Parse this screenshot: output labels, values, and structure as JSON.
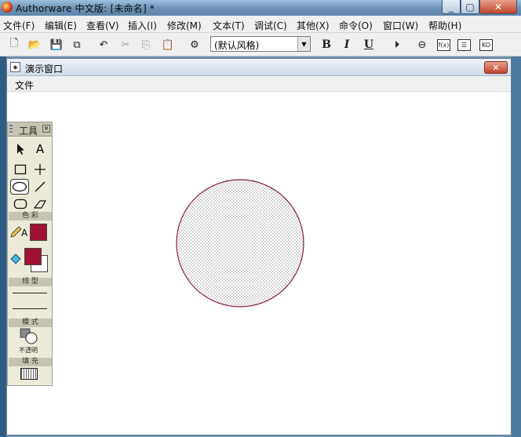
{
  "app": {
    "title": "Authorware 中文版: [未命名] *"
  },
  "menubar": {
    "items": [
      "文件(F)",
      "编辑(E)",
      "查看(V)",
      "插入(I)",
      "修改(M)",
      "文本(T)",
      "调试(C)",
      "其他(X)",
      "命令(O)",
      "窗口(W)",
      "帮助(H)"
    ]
  },
  "toolbar": {
    "style_value": "(默认风格)",
    "bold_label": "B",
    "italic_label": "I",
    "underline_label": "U",
    "ko_label": "KO"
  },
  "presentation_window": {
    "title": "演示窗口",
    "menu_file": "文件",
    "close_label": "✕"
  },
  "toolbox": {
    "title": "工具",
    "section_color": "色 彩",
    "section_line": "线 型",
    "section_mode": "模 式",
    "mode_value": "不透明",
    "section_fill": "填 充",
    "text_tool_label": "A",
    "pen_label": "A"
  },
  "colors": {
    "stroke_color": "#9c1a3c",
    "fill_foreground": "#a01133",
    "fill_background": "#ffffff",
    "circle_outline": "#8b1a4a"
  }
}
